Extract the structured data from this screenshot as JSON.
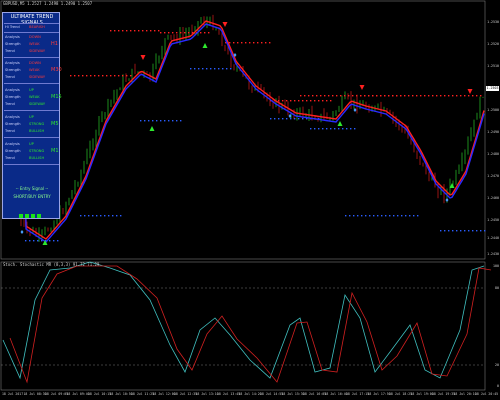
{
  "header": {
    "symbol_line": "GBPUSD,M5  1.2527 1.2498 1.2490 1.2507"
  },
  "signals_panel": {
    "title": "ULTIMATE TREND SIGNALS",
    "rows": [
      {
        "label_a": "Hi Trend",
        "value_a": "BEARISH",
        "tf": "",
        "colors": [
          "#ff3a3a"
        ]
      },
      {
        "label_a": "Analysis",
        "value_a": "DOWN",
        "label_b": "Strength",
        "value_b": "WEAK",
        "label_c": "Trend",
        "value_c": "SIDEWAY",
        "tf": "H1",
        "color": "#ff3a3a"
      },
      {
        "label_a": "Analysis",
        "value_a": "DOWN",
        "label_b": "Strength",
        "value_b": "WEAK",
        "label_c": "Trend",
        "value_c": "SIDEWAY",
        "tf": "M30",
        "color": "#ff3a3a"
      },
      {
        "label_a": "Analysis",
        "value_a": "UP",
        "label_b": "Strength",
        "value_b": "WEAK",
        "label_c": "Trend",
        "value_c": "SIDEWAY",
        "tf": "M15",
        "color": "#2ee82e"
      },
      {
        "label_a": "Analysis",
        "value_a": "UP",
        "label_b": "Strength",
        "value_b": "STRONG",
        "label_c": "Trend",
        "value_c": "BULLISH",
        "tf": "M5",
        "color": "#2ee82e"
      },
      {
        "label_a": "Analysis",
        "value_a": "UP",
        "label_b": "Strength",
        "value_b": "STRONG",
        "label_c": "Trend",
        "value_c": "BULLISH",
        "tf": "M1",
        "color": "#2ee82e"
      }
    ],
    "entry_title": "-- Entry Signal --",
    "entry_signal": "SHORT/BUY ENTRY"
  },
  "price_axis": {
    "labels": [
      "1.2530",
      "1.2520",
      "1.2510",
      "1.2500",
      "1.2490",
      "1.2480",
      "1.2470",
      "1.2460",
      "1.2450",
      "1.2440",
      "1.2430"
    ],
    "current_price": "1.2503"
  },
  "oscillator": {
    "title": "Stoch. Stochastic MR (8,3,3) 91.72 71.29",
    "levels": [
      "100",
      "80",
      "20",
      "0"
    ]
  },
  "time_axis": {
    "labels": [
      "18 Jul 2017",
      "18 Jul 08:30",
      "18 Jul 09:05",
      "18 Jul 09:40",
      "18 Jul 10:15",
      "18 Jul 10:50",
      "18 Jul 11:25",
      "18 Jul 12:00",
      "18 Jul 12:35",
      "18 Jul 13:10",
      "18 Jul 13:45",
      "18 Jul 14:20",
      "18 Jul 14:55",
      "18 Jul 15:30",
      "18 Jul 16:05",
      "18 Jul 16:40",
      "18 Jul 17:15",
      "18 Jul 17:50",
      "18 Jul 18:25",
      "18 Jul 19:00",
      "18 Jul 19:35",
      "18 Jul 20:10",
      "18 Jul 20:45"
    ]
  },
  "colors": {
    "bull": "#2ee82e",
    "bear": "#ff2020",
    "ma_red": "#ff2020",
    "ma_blue": "#2a2aff",
    "dots_red": "#ff2020",
    "dots_blue": "#2a5cff",
    "diamond": "#48a0ff",
    "stoch_main": "#40c0c0",
    "stoch_signal": "#d02020"
  }
}
